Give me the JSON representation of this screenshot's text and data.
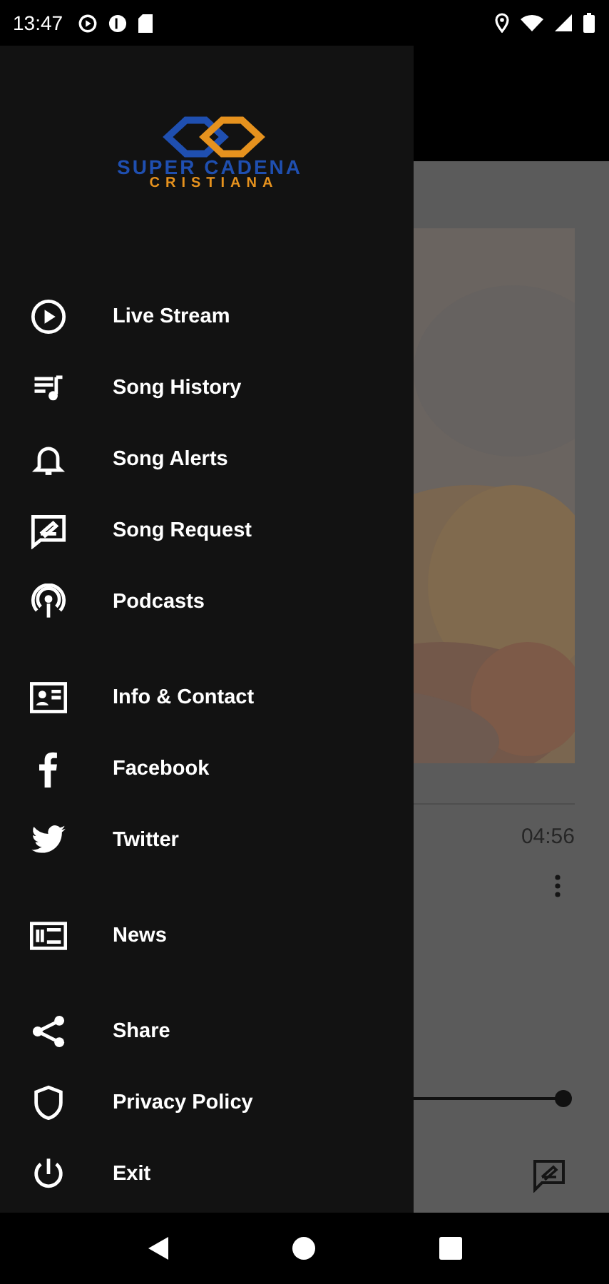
{
  "status_bar": {
    "time": "13:47"
  },
  "drawer": {
    "logo": {
      "line_1": "SUPER CADENA",
      "line_2": "CRISTIANA"
    },
    "sections": [
      {
        "items": [
          {
            "label": "Live Stream"
          },
          {
            "label": "Song History"
          },
          {
            "label": "Song Alerts"
          },
          {
            "label": "Song Request"
          },
          {
            "label": "Podcasts"
          }
        ]
      },
      {
        "items": [
          {
            "label": "Info & Contact"
          },
          {
            "label": "Facebook"
          },
          {
            "label": "Twitter"
          }
        ]
      },
      {
        "items": [
          {
            "label": "News"
          }
        ]
      },
      {
        "items": [
          {
            "label": "Share"
          },
          {
            "label": "Privacy Policy"
          },
          {
            "label": "Exit"
          }
        ]
      }
    ]
  },
  "player": {
    "duration": "04:56",
    "level": 1
  }
}
